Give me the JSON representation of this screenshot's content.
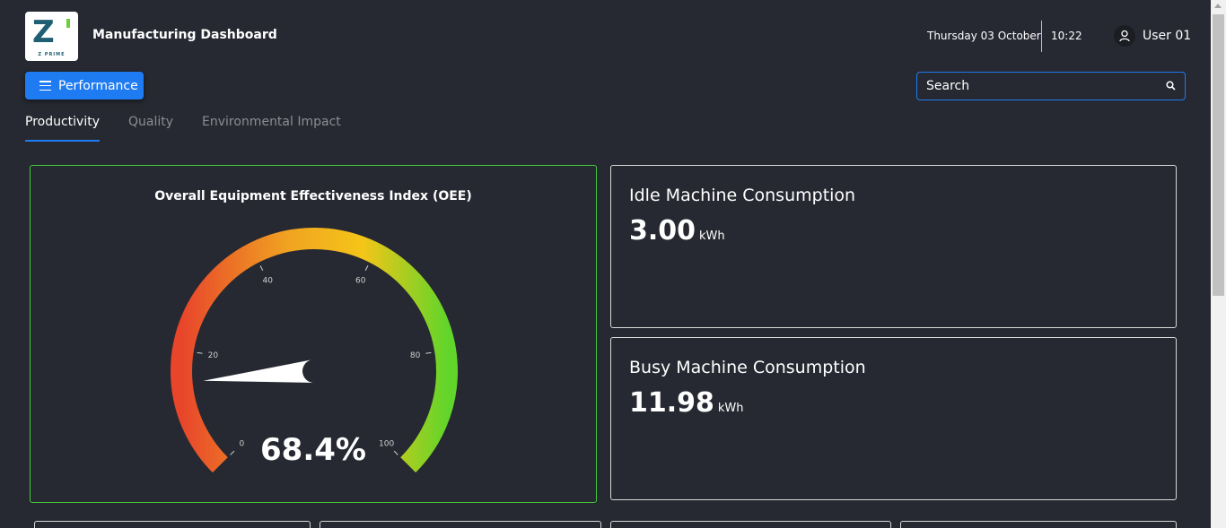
{
  "header": {
    "brand": "Z PRIME",
    "title": "Manufacturing Dashboard",
    "date": "Thursday 03 October",
    "time": "10:22",
    "user": "User 01"
  },
  "toolbar": {
    "menu_label": "Performance"
  },
  "search": {
    "placeholder": "Search"
  },
  "tabs": [
    {
      "label": "Productivity",
      "active": true
    },
    {
      "label": "Quality",
      "active": false
    },
    {
      "label": "Environmental Impact",
      "active": false
    }
  ],
  "oee": {
    "title": "Overall Equipment Effectiveness Index (OEE)",
    "value_text": "68.4%",
    "value": 68.4,
    "min": 0,
    "max": 100,
    "ticks": [
      "0",
      "20",
      "40",
      "60",
      "80",
      "100"
    ],
    "colors": [
      "#e8452b",
      "#f0a321",
      "#f5c518",
      "#62d52a"
    ]
  },
  "kpis": [
    {
      "title": "Idle Machine Consumption",
      "value": "3.00",
      "unit": "kWh"
    },
    {
      "title": "Busy Machine Consumption",
      "value": "11.98",
      "unit": "kWh"
    }
  ]
}
